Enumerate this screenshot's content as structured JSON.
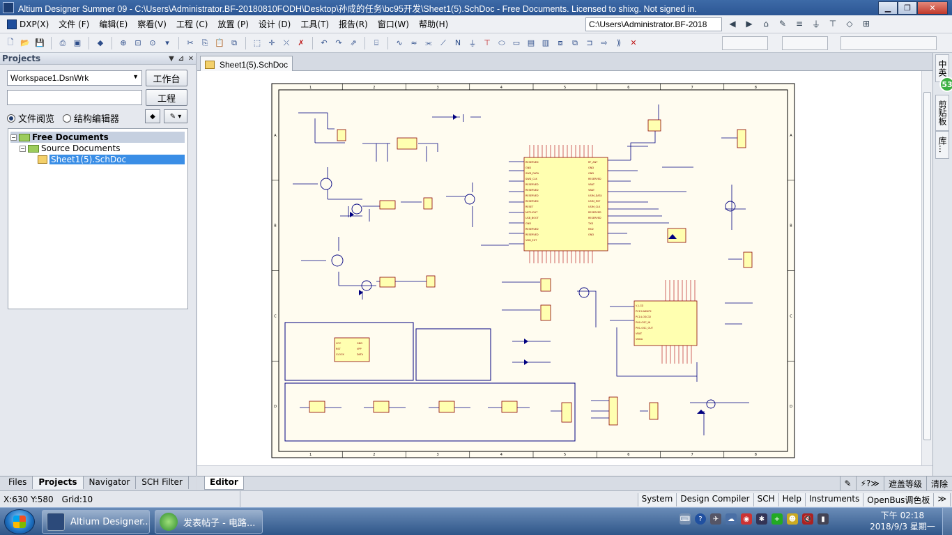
{
  "window": {
    "title": "Altium Designer Summer 09 - C:\\Users\\Administrator.BF-20180810FODH\\Desktop\\孙成的任务\\bc95开发\\Sheet1(5).SchDoc - Free Documents. Licensed to shixg. Not signed in.",
    "minimize": "▁",
    "maximize": "❐",
    "close": "✕"
  },
  "menu": {
    "items": [
      "DXP(X)",
      "文件 (F)",
      "编辑(E)",
      "察看(V)",
      "工程 (C)",
      "放置 (P)",
      "设计 (D)",
      "工具(T)",
      "报告(R)",
      "窗口(W)",
      "帮助(H)"
    ],
    "path": "C:\\Users\\Administrator.BF-2018"
  },
  "left_panel": {
    "title": "Projects",
    "workspace": "Workspace1.DsnWrk",
    "workbench_button": "工作台",
    "project_button": "工程",
    "radio_file_view": "文件阅览",
    "radio_structure_editor": "结构编辑器",
    "tree": {
      "root": "Free Documents",
      "folder": "Source Documents",
      "file": "Sheet1(5).SchDoc"
    },
    "tabs": [
      "Files",
      "Projects",
      "Navigator",
      "SCH Filter"
    ]
  },
  "document": {
    "tab": "Sheet1(5).SchDoc",
    "editor_tab": "Editor",
    "mask_level": "遮盖等级",
    "clear": "清除"
  },
  "schematic": {
    "col_numbers": [
      "1",
      "2",
      "3",
      "4",
      "5",
      "6",
      "7",
      "8"
    ],
    "row_letters": [
      "A",
      "B",
      "C",
      "D"
    ]
  },
  "right_dock": {
    "badge": "53",
    "tabs": [
      "剪贴板",
      "库..."
    ]
  },
  "status": {
    "coords": "X:630 Y:580",
    "grid": "Grid:10",
    "buttons": [
      "System",
      "Design Compiler",
      "SCH",
      "Help",
      "Instruments",
      "OpenBus调色板"
    ]
  },
  "taskbar": {
    "tasks": [
      "Altium Designer...",
      "发表帖子 - 电路..."
    ],
    "time": "下午 02:18",
    "date": "2018/9/3 星期一"
  },
  "colors": {
    "sheet_bg": "#fffcf0",
    "wire": "#000080",
    "component_fill": "#ffffb0",
    "component_stroke": "#8b0000",
    "selection": "#3a8ee6"
  }
}
